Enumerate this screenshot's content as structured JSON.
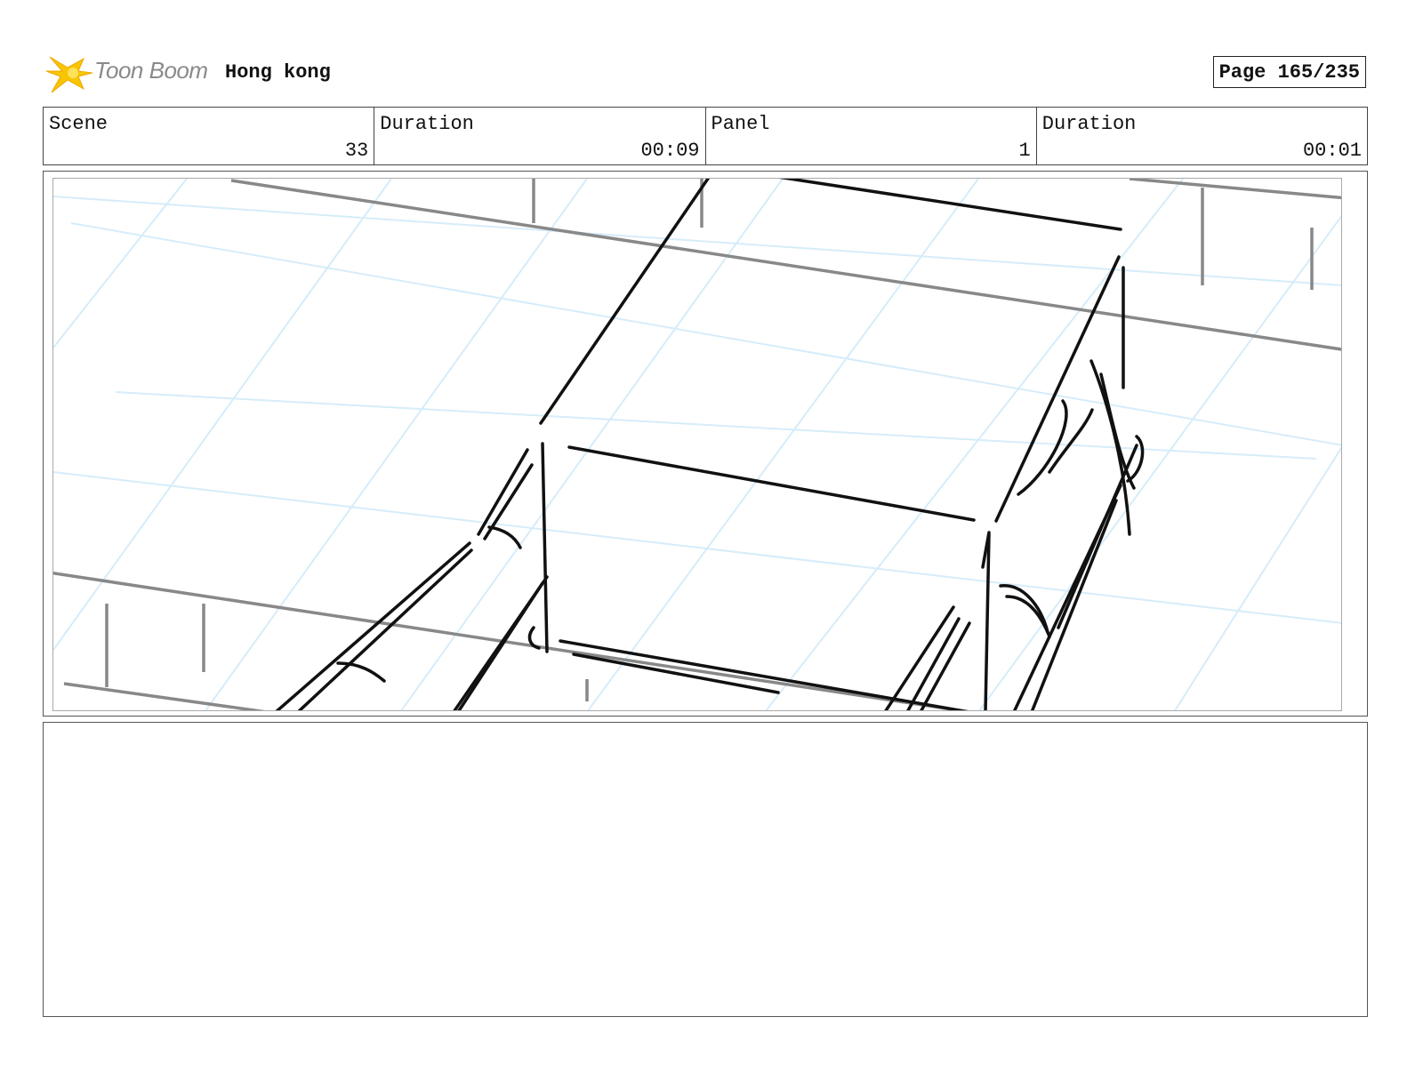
{
  "brand": {
    "logo_text": "Toon Boom",
    "icon": "toon-boom-star-icon",
    "accent": "#f5c400"
  },
  "project": {
    "title": "Hong kong"
  },
  "page": {
    "label": "Page 165/235"
  },
  "info": {
    "scene_label": "Scene",
    "scene_value": "33",
    "scene_duration_label": "Duration",
    "scene_duration_value": "00:09",
    "panel_label": "Panel",
    "panel_value": "1",
    "panel_duration_label": "Duration",
    "panel_duration_value": "00:01"
  },
  "panel": {
    "sketch": "rough-sketch-drawing",
    "grid_color": "#d6ecfa",
    "line_color": "#111111"
  },
  "notes": {
    "text": ""
  }
}
